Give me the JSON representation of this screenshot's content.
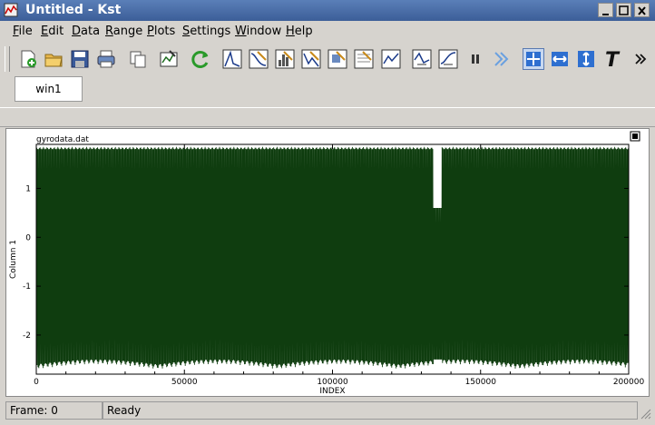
{
  "window": {
    "title": "Untitled - Kst",
    "controls": [
      "minimize-icon",
      "maximize-icon",
      "close-icon"
    ]
  },
  "menu": [
    {
      "underline": "F",
      "rest": "ile"
    },
    {
      "underline": "E",
      "rest": "dit"
    },
    {
      "underline": "D",
      "rest": "ata"
    },
    {
      "underline": "R",
      "rest": "ange"
    },
    {
      "underline": "P",
      "rest": "lots"
    },
    {
      "underline": "S",
      "rest": "ettings"
    },
    {
      "underline": "W",
      "rest": "indow"
    },
    {
      "underline": "H",
      "rest": "elp"
    }
  ],
  "toolbar": {
    "icons": [
      "new-icon",
      "open-folder-icon",
      "save-icon",
      "print-icon",
      "copy-icon",
      "data-wizard-icon",
      "reload-icon",
      "curve-icon",
      "equation-icon",
      "histogram-icon",
      "power-spectrum-icon",
      "plugin-icon",
      "event-monitor-icon",
      "matrix-icon",
      "image-icon",
      "fit-icon",
      "filter-icon",
      "pause-icon",
      "forward-icon",
      "xy-zoom-icon",
      "x-zoom-icon",
      "y-zoom-icon",
      "text-annotation-icon",
      "overflow-icon"
    ],
    "accent": "#2e6fd0"
  },
  "tabs": [
    {
      "label": "win1"
    }
  ],
  "plot": {
    "filename": "gyrodata.dat",
    "xlabel": "INDEX",
    "ylabel": "Column 1",
    "line_color": "#0f3d0f"
  },
  "chart_data": {
    "type": "line",
    "title": "gyrodata.dat",
    "xlabel": "INDEX",
    "ylabel": "Column 1",
    "xlim": [
      0,
      200000
    ],
    "ylim": [
      -2.8,
      1.9
    ],
    "x_ticks": [
      0,
      50000,
      100000,
      150000,
      200000
    ],
    "y_ticks": [
      -2,
      -1,
      0,
      1
    ],
    "series": [
      {
        "x_range": [
          0,
          200000
        ],
        "y_min": -2.7,
        "y_max": 1.85
      }
    ],
    "grid": false,
    "legend": "none"
  },
  "status": {
    "frame": "Frame:  0",
    "state": "Ready"
  }
}
